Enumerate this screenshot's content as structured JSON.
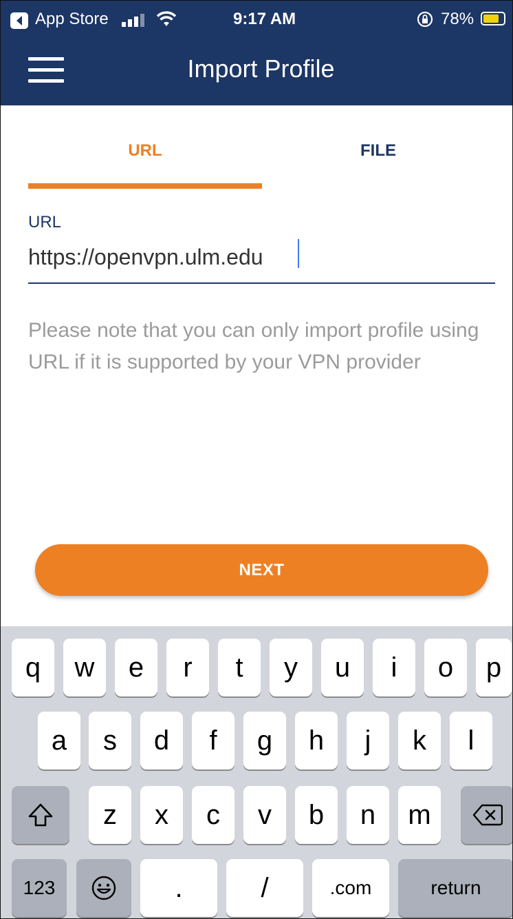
{
  "status_bar": {
    "back_app": "App Store",
    "time": "9:17 AM",
    "battery": "78%",
    "battery_level": 0.78,
    "icons": [
      "back-arrow-icon",
      "cellular-signal-icon",
      "wifi-icon",
      "orientation-lock-icon",
      "battery-icon"
    ]
  },
  "nav": {
    "title": "Import Profile",
    "menu_icon": "hamburger-menu-icon"
  },
  "tabs": [
    {
      "label": "URL",
      "active": true
    },
    {
      "label": "FILE",
      "active": false
    }
  ],
  "form": {
    "url_label": "URL",
    "url_value": "https://openvpn.ulm.edu",
    "note": "Please note that you can only import profile using URL if it is supported by your VPN provider"
  },
  "next_button": "NEXT",
  "colors": {
    "header": "#1c3665",
    "accent": "#ee8024",
    "note_text": "#9b9b9b"
  },
  "keyboard": {
    "row1": [
      "q",
      "w",
      "e",
      "r",
      "t",
      "y",
      "u",
      "i",
      "o",
      "p"
    ],
    "row2": [
      "a",
      "s",
      "d",
      "f",
      "g",
      "h",
      "j",
      "k",
      "l"
    ],
    "row3": [
      "z",
      "x",
      "c",
      "v",
      "b",
      "n",
      "m"
    ],
    "shift_icon": "shift-icon",
    "delete_icon": "backspace-icon",
    "numbers_key": "123",
    "emoji_icon": "emoji-icon",
    "period_key": ".",
    "slash_key": "/",
    "dotcom_key": ".com",
    "return_key": "return"
  }
}
